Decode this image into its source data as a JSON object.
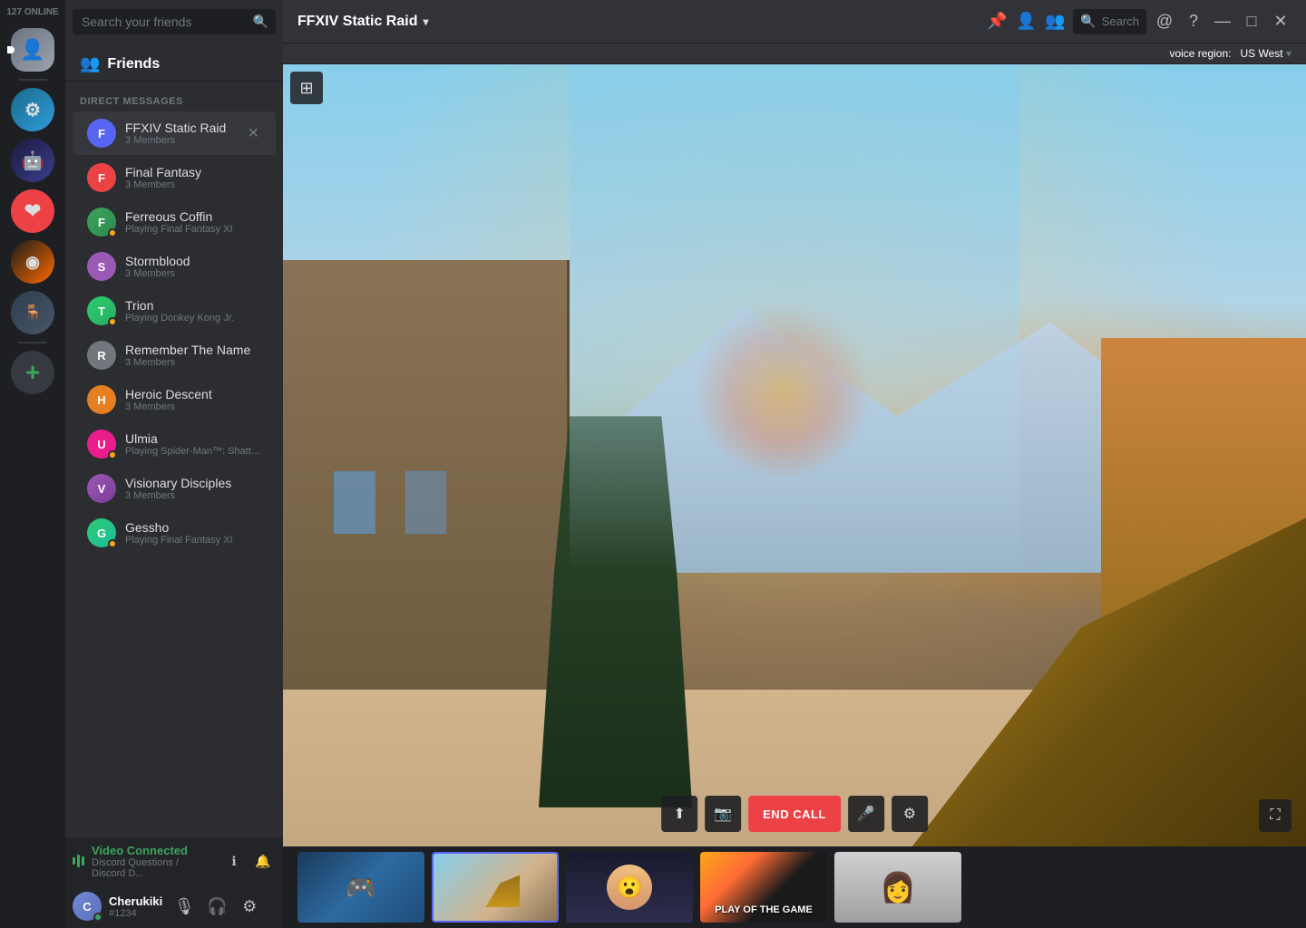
{
  "serverSidebar": {
    "onlineCount": "127 ONLINE",
    "servers": [
      {
        "id": "home",
        "label": "Home",
        "icon": "🏠",
        "colorClass": "av-blue",
        "active": true
      },
      {
        "id": "guild1",
        "label": "Guild 1",
        "icon": "⚙",
        "colorClass": "av-teal"
      },
      {
        "id": "guild2",
        "label": "Guild 2",
        "icon": "🤖",
        "colorClass": "av-purple"
      },
      {
        "id": "guild3",
        "label": "Guild 3",
        "icon": "❤",
        "colorClass": "av-red"
      },
      {
        "id": "guild4",
        "label": "Overwatch",
        "icon": "◉",
        "colorClass": "av-orange"
      },
      {
        "id": "guild5",
        "label": "Chair",
        "icon": "🪑",
        "colorClass": "av-gray"
      },
      {
        "id": "add",
        "label": "Add Server",
        "icon": "+",
        "colorClass": "add"
      }
    ]
  },
  "friendsSidebar": {
    "searchPlaceholder": "Search your friends",
    "friendsLabel": "Friends",
    "dmSectionLabel": "DIRECT MESSAGES",
    "dmItems": [
      {
        "id": "ffxiv",
        "name": "FFXIV Static Raid",
        "sub": "3 Members",
        "active": true,
        "avatarColor": "av-blue",
        "avatarText": "F"
      },
      {
        "id": "ff",
        "name": "Final Fantasy",
        "sub": "3 Members",
        "active": false,
        "avatarColor": "av-red",
        "avatarText": "F"
      },
      {
        "id": "ferreous",
        "name": "Ferreous Coffin",
        "sub": "Playing Final Fantasy XI",
        "active": false,
        "avatarColor": "av-green",
        "avatarText": "F"
      },
      {
        "id": "storm",
        "name": "Stormblood",
        "sub": "3 Members",
        "active": false,
        "avatarColor": "av-purple",
        "avatarText": "S"
      },
      {
        "id": "trion",
        "name": "Trion",
        "sub": "Playing Donkey Kong Jr.",
        "active": false,
        "avatarColor": "av-teal",
        "avatarText": "T"
      },
      {
        "id": "remember",
        "name": "Remember The Name",
        "sub": "3 Members",
        "active": false,
        "avatarColor": "av-gray",
        "avatarText": "R"
      },
      {
        "id": "heroic",
        "name": "Heroic Descent",
        "sub": "3 Members",
        "active": false,
        "avatarColor": "av-orange",
        "avatarText": "H"
      },
      {
        "id": "ulmia",
        "name": "Ulmia",
        "sub": "Playing Spider-Man™: Shattered Dimen...",
        "active": false,
        "avatarColor": "av-pink",
        "avatarText": "U"
      },
      {
        "id": "visionary",
        "name": "Visionary Disciples",
        "sub": "3 Members",
        "active": false,
        "avatarColor": "av-purple",
        "avatarText": "V"
      },
      {
        "id": "gessho",
        "name": "Gessho",
        "sub": "Playing Final Fantasy XI",
        "active": false,
        "avatarColor": "av-teal",
        "avatarText": "G"
      }
    ]
  },
  "topBar": {
    "channelName": "FFXIV Static Raid",
    "dropdownArrow": "▾",
    "searchPlaceholder": "Search",
    "voiceRegionLabel": "voice region:",
    "voiceRegionValue": "US West",
    "dropdownArrowSmall": "▾"
  },
  "videoControls": {
    "endCallLabel": "END CALL"
  },
  "bottomBar": {
    "voiceStatusTitle": "Video Connected",
    "voiceStatusSub": "Discord Questions / Discord D...",
    "userName": "Cherukiki",
    "userTag": "#1234"
  },
  "icons": {
    "search": "🔍",
    "friends": "👥",
    "pin": "📌",
    "addFriend": "👤+",
    "manageMembers": "👥",
    "mention": "@",
    "help": "?",
    "minimize": "—",
    "maximize": "□",
    "close": "✕",
    "share": "⬆",
    "camera": "📷",
    "mute": "🎤",
    "settings": "⚙",
    "fullscreen": "⛶",
    "layout": "⊞",
    "mic": "🎙",
    "headphones": "🎧",
    "gear": "⚙",
    "info": "ℹ",
    "activityFeed": "🔔"
  }
}
